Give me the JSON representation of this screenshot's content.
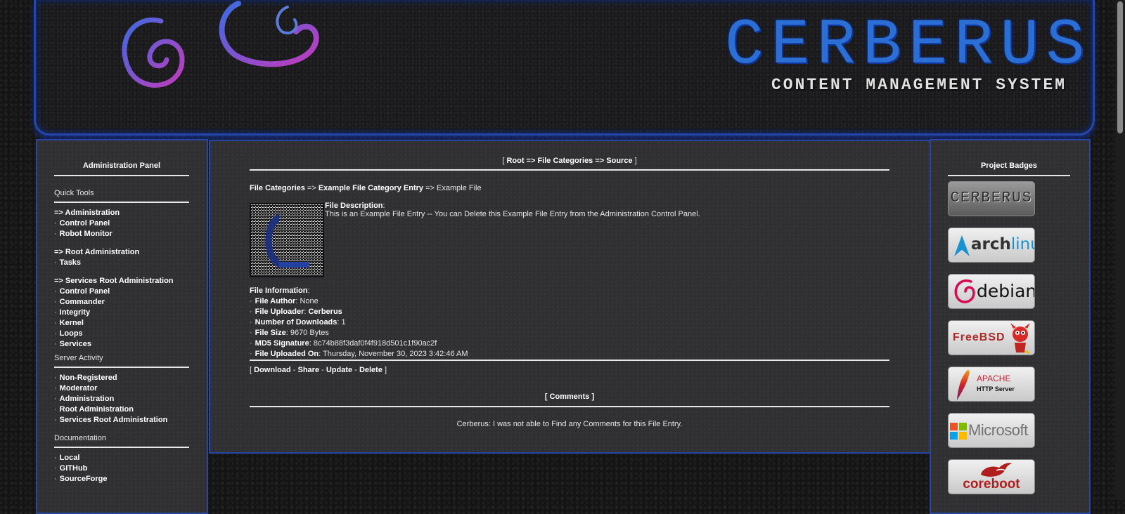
{
  "header": {
    "logo_title": "CERBERUS",
    "logo_subtitle": "CONTENT MANAGEMENT SYSTEM"
  },
  "sidebar": {
    "title": "Administration Panel",
    "quick_tools": {
      "heading": "Quick Tools",
      "groups": [
        {
          "title": "=> Administration",
          "items": [
            "Control Panel",
            "Robot Monitor"
          ]
        },
        {
          "title": "=> Root Administration",
          "items": [
            "Tasks"
          ]
        },
        {
          "title": "=> Services Root Administration",
          "items": [
            "Control Panel",
            "Commander",
            "Integrity",
            "Kernel",
            "Loops",
            "Services"
          ]
        }
      ]
    },
    "server_activity": {
      "heading": "Server Activity",
      "items": [
        "Non-Registered",
        "Moderator",
        "Administration",
        "Root Administration",
        "Services Root Administration"
      ]
    },
    "documentation": {
      "heading": "Documentation",
      "items": [
        "Local",
        "GITHub",
        "SourceForge"
      ]
    }
  },
  "main": {
    "breadcrumb": {
      "open": "[",
      "path": "Root => File Categories => Source",
      "close": "]"
    },
    "trail": {
      "root": "File Categories",
      "sep1": "=>",
      "category": "Example File Category Entry",
      "sep2": "=>",
      "current": "Example File"
    },
    "description": {
      "label": "File Description",
      "text": "This is an Example File Entry -- You can Delete this Example File Entry from the Administration Control Panel."
    },
    "info": {
      "heading": "File Information",
      "rows": [
        {
          "label": "File Author",
          "value": "None"
        },
        {
          "label": "File Uploader",
          "value": "Cerberus"
        },
        {
          "label": "Number of Downloads",
          "value": "1"
        },
        {
          "label": "File Size",
          "value": "9670 Bytes"
        },
        {
          "label": "MD5 Signature",
          "value": "8c74b88f3daf0f4f918d501c1f90ac2f"
        },
        {
          "label": "File Uploaded On",
          "value": "Thursday, November 30, 2023 3:42:46 AM"
        }
      ]
    },
    "actions": {
      "open": "[",
      "download": "Download",
      "share": "Share",
      "update": "Update",
      "delete": "Delete",
      "sep": "-",
      "close": "]"
    },
    "comments": {
      "heading": "[ Comments ]",
      "empty_message": "Cerberus: I was not able to Find any Comments for this File Entry."
    }
  },
  "right_panel": {
    "title": "Project Badges",
    "badges": [
      {
        "name": "cerberus-badge",
        "text": "CERBERUS",
        "color": "#3a3a3a"
      },
      {
        "name": "archlinux-badge",
        "text1": "arch",
        "text2": "linux",
        "color": "#1793d1"
      },
      {
        "name": "debian-badge",
        "text": "debian",
        "color": "#d70a53"
      },
      {
        "name": "freebsd-badge",
        "text": "FreeBSD",
        "color": "#ab2b28"
      },
      {
        "name": "apache-badge",
        "text1": "APACHE",
        "text2": "HTTP Server",
        "color": "#c92037"
      },
      {
        "name": "microsoft-badge",
        "text": "Microsoft",
        "color": "#737373"
      },
      {
        "name": "coreboot-badge",
        "text": "coreboot",
        "color": "#b01d1d"
      }
    ]
  }
}
